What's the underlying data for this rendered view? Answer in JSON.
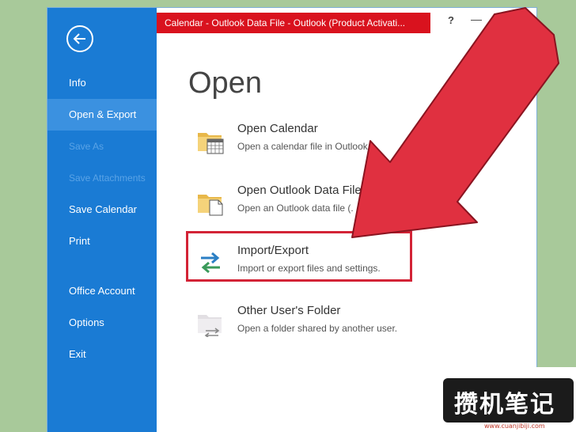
{
  "window": {
    "title": "Calendar - Outlook Data File -  Outlook (Product Activati...",
    "help_label": "?",
    "minimize_label": "—"
  },
  "sidebar": {
    "items": [
      {
        "label": "Info",
        "state": "normal"
      },
      {
        "label": "Open & Export",
        "state": "active"
      },
      {
        "label": "Save As",
        "state": "disabled"
      },
      {
        "label": "Save Attachments",
        "state": "disabled"
      },
      {
        "label": "Save Calendar",
        "state": "normal"
      },
      {
        "label": "Print",
        "state": "normal"
      },
      {
        "label": "Office Account",
        "state": "normal"
      },
      {
        "label": "Options",
        "state": "normal"
      },
      {
        "label": "Exit",
        "state": "normal"
      }
    ]
  },
  "main": {
    "heading": "Open",
    "options": [
      {
        "title": "Open Calendar",
        "desc": "Open a calendar file in Outlook",
        "icon": "calendar-folder-icon"
      },
      {
        "title": "Open Outlook Data File",
        "desc": "Open an Outlook data file (.",
        "icon": "data-file-folder-icon"
      },
      {
        "title": "Import/Export",
        "desc": "Import or export files and settings.",
        "icon": "import-export-arrows-icon"
      },
      {
        "title": "Other User's Folder",
        "desc": "Open a folder shared by another user.",
        "icon": "shared-folder-icon"
      }
    ]
  },
  "watermark": {
    "text": "攒机笔记",
    "url": "www.cuanjibiji.com"
  },
  "colors": {
    "sidebar": "#1a7bd4",
    "sidebar_active": "#3b91e0",
    "titlebar": "#d9121e",
    "highlight": "#d32336",
    "arrow": "#e03040",
    "background": "#a8c99a"
  }
}
